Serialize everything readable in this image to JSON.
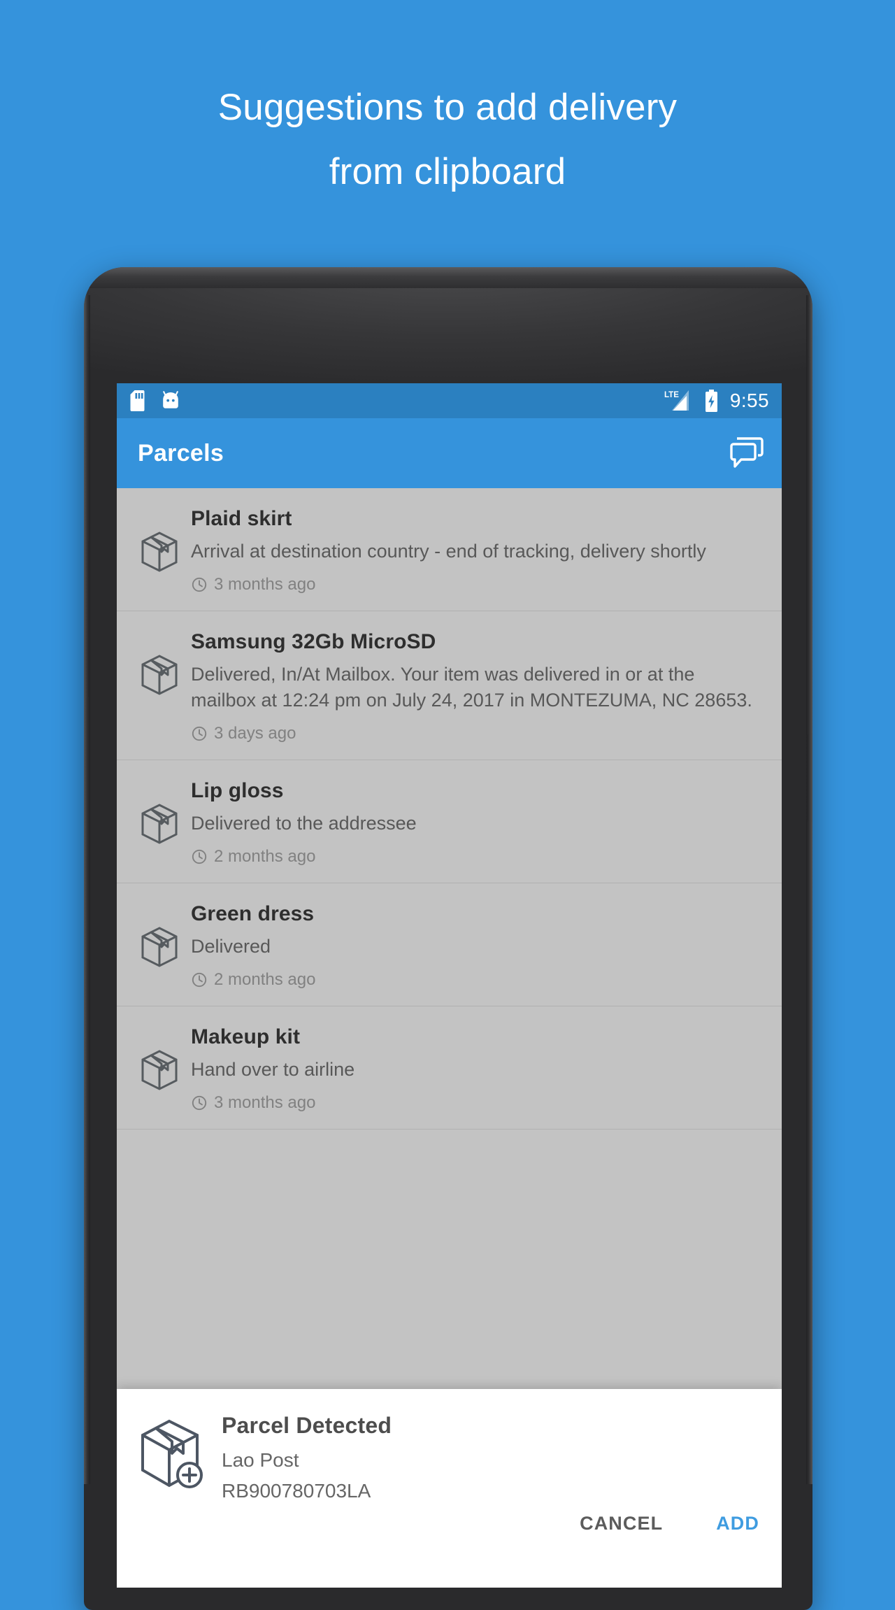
{
  "promo": {
    "line1": "Suggestions to add delivery",
    "line2": "from clipboard"
  },
  "colors": {
    "background": "#3593dc",
    "app_bar": "#3593dc",
    "status_bar": "#2b80c0",
    "accent": "#3f9ce0",
    "dialog_bg": "#ffffff"
  },
  "status_bar": {
    "time": "9:55",
    "icons": [
      "sd-card-icon",
      "android-head-icon",
      "lte-signal-icon",
      "battery-charging-icon"
    ],
    "network_label": "LTE"
  },
  "app_bar": {
    "title": "Parcels",
    "action_icon": "feedback-chat-icon"
  },
  "parcels": [
    {
      "title": "Plaid skirt",
      "status": "Arrival at destination country - end of tracking, delivery shortly",
      "time": "3 months ago"
    },
    {
      "title": "Samsung 32Gb MicroSD",
      "status": "Delivered, In/At Mailbox. Your item was delivered in or at the mailbox at 12:24 pm on July 24, 2017 in MONTEZUMA, NC 28653.",
      "time": "3 days ago"
    },
    {
      "title": "Lip gloss",
      "status": "Delivered to the addressee",
      "time": "2 months ago"
    },
    {
      "title": "Green dress",
      "status": "Delivered",
      "time": "2 months ago"
    },
    {
      "title": "Makeup kit",
      "status": "Hand over to airline",
      "time": "3 months ago"
    }
  ],
  "dialog": {
    "icon": "parcel-add-icon",
    "title": "Parcel Detected",
    "carrier": "Lao Post",
    "tracking_number": "RB900780703LA",
    "cancel_label": "CANCEL",
    "add_label": "ADD"
  }
}
